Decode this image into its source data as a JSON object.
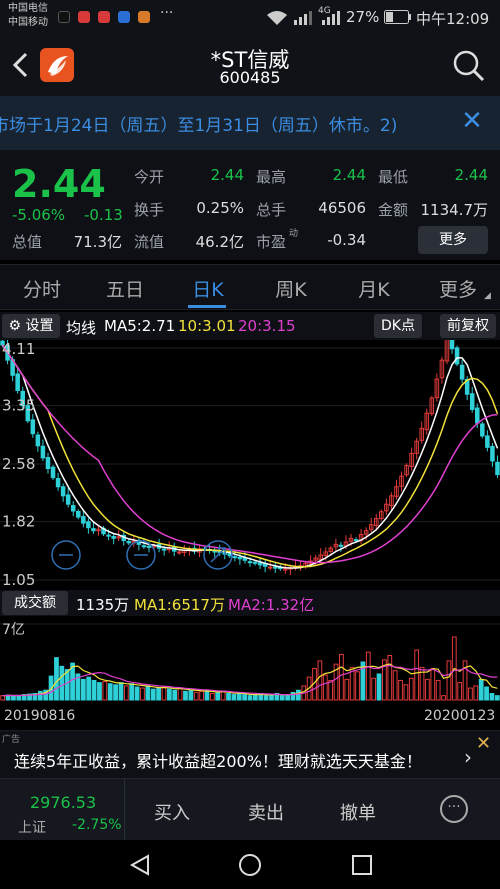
{
  "status_bar": {
    "carrier1": "中国电信",
    "carrier2": "中国移动",
    "network": "4G",
    "battery": "27%",
    "time": "中午12:09"
  },
  "header": {
    "back_icon": "back-arrow-icon",
    "title": "*ST信威",
    "code": "600485",
    "search_icon": "search-icon"
  },
  "notice": {
    "text": "市场于1月24日（周五）至1月31日（周五）休市。2)",
    "close_icon": "close-icon"
  },
  "quote": {
    "price": "2.44",
    "change_pct": "-5.06%",
    "change": "-0.13",
    "total_value_label": "总值",
    "total_value": "71.3亿",
    "open_label": "今开",
    "open": "2.44",
    "high_label": "最高",
    "high": "2.44",
    "low_label": "最低",
    "low": "2.44",
    "turnover_label": "换手",
    "turnover": "0.25%",
    "volume_label": "总手",
    "volume": "46506",
    "amount_label": "金额",
    "amount": "1134.7万",
    "float_label": "流值",
    "float_value": "46.2亿",
    "pe_label": "市盈",
    "pe_sup": "动",
    "pe": "-0.34",
    "more_button": "更多"
  },
  "tabs": [
    {
      "label": "分时"
    },
    {
      "label": "五日"
    },
    {
      "label": "日K"
    },
    {
      "label": "周K"
    },
    {
      "label": "月K"
    },
    {
      "label": "更多"
    }
  ],
  "active_tab": "日K",
  "ma_bar": {
    "settings_label": "设置",
    "ma_label": "均线",
    "ma5": "MA5:2.71",
    "ma10": "10:3.01",
    "ma20": "20:3.15",
    "dk_button": "DK点",
    "adjust_button": "前复权"
  },
  "vol_bar": {
    "label": "成交额",
    "amount": "1135万",
    "ma1": "MA1:6517万",
    "ma2": "MA2:1.32亿"
  },
  "colors": {
    "up": "#e23b3b",
    "down": "#2fd0d8",
    "ma5": "#ffffff",
    "ma10": "#f2e23a",
    "ma20": "#e040d0",
    "accent": "#3a8de0",
    "green": "#1bc24a"
  },
  "chart_data": [
    {
      "type": "candlestick",
      "y_ticks": [
        "4.11",
        "3.35",
        "2.58",
        "1.82",
        "1.05"
      ],
      "ylim": [
        1.05,
        4.11
      ],
      "x_start": "20190816",
      "x_end": "20200123",
      "series": [
        {
          "name": "MA5",
          "value": 2.71
        },
        {
          "name": "10",
          "value": 3.01
        },
        {
          "name": "20",
          "value": 3.15
        }
      ],
      "close": [
        4.15,
        3.95,
        3.75,
        3.55,
        3.35,
        3.15,
        2.98,
        2.82,
        2.66,
        2.52,
        2.4,
        2.28,
        2.16,
        2.05,
        1.96,
        1.88,
        1.8,
        1.74,
        1.7,
        1.72,
        1.66,
        1.63,
        1.6,
        1.62,
        1.57,
        1.54,
        1.56,
        1.52,
        1.5,
        1.48,
        1.5,
        1.47,
        1.45,
        1.47,
        1.43,
        1.42,
        1.44,
        1.45,
        1.43,
        1.46,
        1.44,
        1.45,
        1.43,
        1.41,
        1.39,
        1.37,
        1.35,
        1.33,
        1.31,
        1.29,
        1.27,
        1.25,
        1.23,
        1.22,
        1.21,
        1.2,
        1.2,
        1.21,
        1.22,
        1.24,
        1.27,
        1.3,
        1.34,
        1.38,
        1.42,
        1.47,
        1.52,
        1.5,
        1.55,
        1.6,
        1.58,
        1.65,
        1.7,
        1.78,
        1.86,
        1.95,
        2.05,
        2.16,
        2.28,
        2.42,
        2.56,
        2.72,
        2.88,
        3.05,
        3.25,
        3.45,
        3.7,
        3.95,
        4.25,
        4.1,
        3.9,
        3.7,
        3.5,
        3.3,
        3.12,
        2.95,
        2.8,
        2.62,
        2.44
      ]
    },
    {
      "type": "bar",
      "y_tick": "7亿",
      "values": [
        0.4,
        0.45,
        0.38,
        0.42,
        0.5,
        0.55,
        0.6,
        0.8,
        0.9,
        2.2,
        3.9,
        3.1,
        2.8,
        3.4,
        2.4,
        1.9,
        2.1,
        1.8,
        1.6,
        1.7,
        1.5,
        1.4,
        1.6,
        1.3,
        1.5,
        1.2,
        1.1,
        1.3,
        1.0,
        1.1,
        1.2,
        1.0,
        0.9,
        1.1,
        0.8,
        0.9,
        0.7,
        0.8,
        0.9,
        0.6,
        0.7,
        0.8,
        0.6,
        0.5,
        0.6,
        0.5,
        0.4,
        0.5,
        0.6,
        0.4,
        0.5,
        0.6,
        0.4,
        0.5,
        0.7,
        0.9,
        1.3,
        2.1,
        2.9,
        3.6,
        2.3,
        1.8,
        3.3,
        4.2,
        1.9,
        3.0,
        2.6,
        3.5,
        4.4,
        2.0,
        2.4,
        3.7,
        4.1,
        2.7,
        1.8,
        1.4,
        2.0,
        4.6,
        3.0,
        1.9,
        2.9,
        1.8,
        0.4,
        3.6,
        5.8,
        1.6,
        3.6,
        1.1,
        1.3,
        1.9,
        1.2,
        0.6,
        0.4
      ]
    }
  ],
  "ad": {
    "tag": "广告",
    "text": "连续5年正收益，累计收益超200%！理财就选天天基金！",
    "close_icon": "close-icon",
    "arrow_icon": "chevron-right-icon"
  },
  "trade_bar": {
    "index_value": "2976.53",
    "index_name": "上证",
    "index_change": "-2.75%",
    "buy": "买入",
    "sell": "卖出",
    "cancel": "撤单"
  }
}
